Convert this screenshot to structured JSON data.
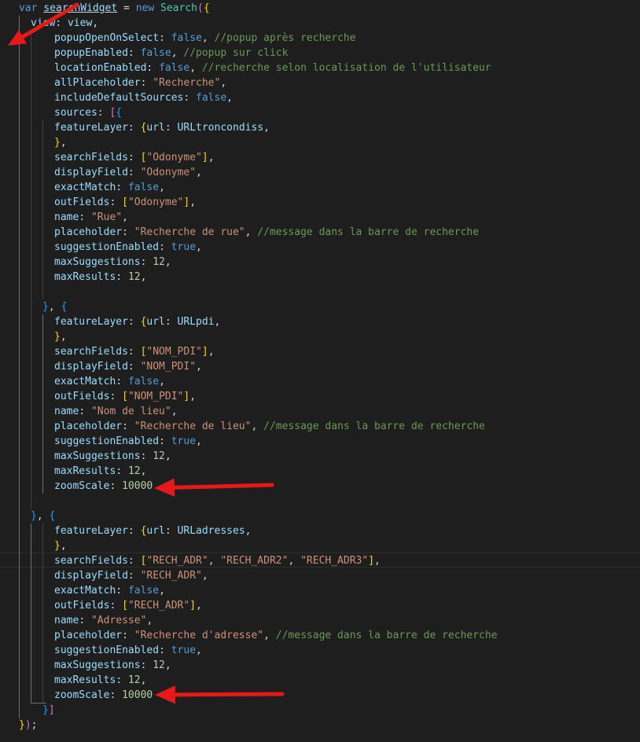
{
  "editor": {
    "language": "javascript",
    "lines": [
      {
        "indent": 0,
        "tokens": [
          [
            "kw",
            "var"
          ],
          [
            "p",
            " "
          ],
          [
            "var",
            "searchWidget"
          ],
          [
            "p",
            " = "
          ],
          [
            "kw",
            "new"
          ],
          [
            "p",
            " "
          ],
          [
            "cls",
            "Search"
          ],
          [
            "b2",
            "("
          ],
          [
            "b1",
            "{"
          ]
        ]
      },
      {
        "indent": 1,
        "tokens": [
          [
            "var",
            "view"
          ],
          [
            "p",
            ": "
          ],
          [
            "var",
            "view"
          ],
          [
            "p",
            ","
          ]
        ]
      },
      {
        "indent": 2,
        "tokens": [
          [
            "var",
            "popupOpenOnSelect"
          ],
          [
            "p",
            ": "
          ],
          [
            "kw",
            "false"
          ],
          [
            "p",
            ", "
          ],
          [
            "cmt",
            "//popup après recherche"
          ]
        ]
      },
      {
        "indent": 2,
        "tokens": [
          [
            "var",
            "popupEnabled"
          ],
          [
            "p",
            ": "
          ],
          [
            "kw",
            "false"
          ],
          [
            "p",
            ", "
          ],
          [
            "cmt",
            "//popup sur click"
          ]
        ]
      },
      {
        "indent": 2,
        "tokens": [
          [
            "var",
            "locationEnabled"
          ],
          [
            "p",
            ": "
          ],
          [
            "kw",
            "false"
          ],
          [
            "p",
            ", "
          ],
          [
            "cmt",
            "//recherche selon localisation de l'utilisateur"
          ]
        ]
      },
      {
        "indent": 2,
        "tokens": [
          [
            "var",
            "allPlaceholder"
          ],
          [
            "p",
            ": "
          ],
          [
            "str",
            "\"Recherche\""
          ],
          [
            "p",
            ","
          ]
        ]
      },
      {
        "indent": 2,
        "tokens": [
          [
            "var",
            "includeDefaultSources"
          ],
          [
            "p",
            ": "
          ],
          [
            "kw",
            "false"
          ],
          [
            "p",
            ","
          ]
        ]
      },
      {
        "indent": 2,
        "tokens": [
          [
            "var",
            "sources"
          ],
          [
            "p",
            ": "
          ],
          [
            "b2",
            "["
          ],
          [
            "b3",
            "{"
          ]
        ]
      },
      {
        "indent": 2,
        "tokens": [
          [
            "var",
            "featureLayer"
          ],
          [
            "p",
            ": "
          ],
          [
            "b1",
            "{"
          ],
          [
            "var",
            "url"
          ],
          [
            "p",
            ": "
          ],
          [
            "var",
            "URLtroncondiss"
          ],
          [
            "p",
            ","
          ]
        ]
      },
      {
        "indent": 2,
        "tokens": [
          [
            "b1",
            "}"
          ],
          [
            "p",
            ","
          ]
        ]
      },
      {
        "indent": 2,
        "tokens": [
          [
            "var",
            "searchFields"
          ],
          [
            "p",
            ": "
          ],
          [
            "b1",
            "["
          ],
          [
            "str",
            "\"Odonyme\""
          ],
          [
            "b1",
            "]"
          ],
          [
            "p",
            ","
          ]
        ]
      },
      {
        "indent": 2,
        "tokens": [
          [
            "var",
            "displayField"
          ],
          [
            "p",
            ": "
          ],
          [
            "str",
            "\"Odonyme\""
          ],
          [
            "p",
            ","
          ]
        ]
      },
      {
        "indent": 2,
        "tokens": [
          [
            "var",
            "exactMatch"
          ],
          [
            "p",
            ": "
          ],
          [
            "kw",
            "false"
          ],
          [
            "p",
            ","
          ]
        ]
      },
      {
        "indent": 2,
        "tokens": [
          [
            "var",
            "outFields"
          ],
          [
            "p",
            ": "
          ],
          [
            "b1",
            "["
          ],
          [
            "str",
            "\"Odonyme\""
          ],
          [
            "b1",
            "]"
          ],
          [
            "p",
            ","
          ]
        ]
      },
      {
        "indent": 2,
        "tokens": [
          [
            "var",
            "name"
          ],
          [
            "p",
            ": "
          ],
          [
            "str",
            "\"Rue\""
          ],
          [
            "p",
            ","
          ]
        ]
      },
      {
        "indent": 2,
        "tokens": [
          [
            "var",
            "placeholder"
          ],
          [
            "p",
            ": "
          ],
          [
            "str",
            "\"Recherche de rue\""
          ],
          [
            "p",
            ", "
          ],
          [
            "cmt",
            "//message dans la barre de recherche"
          ]
        ]
      },
      {
        "indent": 2,
        "tokens": [
          [
            "var",
            "suggestionEnabled"
          ],
          [
            "p",
            ": "
          ],
          [
            "kw",
            "true"
          ],
          [
            "p",
            ","
          ]
        ]
      },
      {
        "indent": 2,
        "tokens": [
          [
            "var",
            "maxSuggestions"
          ],
          [
            "p",
            ": "
          ],
          [
            "num",
            "12"
          ],
          [
            "p",
            ","
          ]
        ]
      },
      {
        "indent": 2,
        "tokens": [
          [
            "var",
            "maxResults"
          ],
          [
            "p",
            ": "
          ],
          [
            "num",
            "12"
          ],
          [
            "p",
            ","
          ]
        ]
      },
      {
        "indent": 0,
        "tokens": []
      },
      {
        "indent": 1.5,
        "tokens": [
          [
            "b3",
            "}"
          ],
          [
            "p",
            ", "
          ],
          [
            "b3",
            "{"
          ]
        ]
      },
      {
        "indent": 2,
        "tokens": [
          [
            "var",
            "featureLayer"
          ],
          [
            "p",
            ": "
          ],
          [
            "b1",
            "{"
          ],
          [
            "var",
            "url"
          ],
          [
            "p",
            ": "
          ],
          [
            "var",
            "URLpdi"
          ],
          [
            "p",
            ","
          ]
        ]
      },
      {
        "indent": 2,
        "tokens": [
          [
            "b1",
            "}"
          ],
          [
            "p",
            ","
          ]
        ]
      },
      {
        "indent": 2,
        "tokens": [
          [
            "var",
            "searchFields"
          ],
          [
            "p",
            ": "
          ],
          [
            "b1",
            "["
          ],
          [
            "str",
            "\"NOM_PDI\""
          ],
          [
            "b1",
            "]"
          ],
          [
            "p",
            ","
          ]
        ]
      },
      {
        "indent": 2,
        "tokens": [
          [
            "var",
            "displayField"
          ],
          [
            "p",
            ": "
          ],
          [
            "str",
            "\"NOM_PDI\""
          ],
          [
            "p",
            ","
          ]
        ]
      },
      {
        "indent": 2,
        "tokens": [
          [
            "var",
            "exactMatch"
          ],
          [
            "p",
            ": "
          ],
          [
            "kw",
            "false"
          ],
          [
            "p",
            ","
          ]
        ]
      },
      {
        "indent": 2,
        "tokens": [
          [
            "var",
            "outFields"
          ],
          [
            "p",
            ": "
          ],
          [
            "b1",
            "["
          ],
          [
            "str",
            "\"NOM_PDI\""
          ],
          [
            "b1",
            "]"
          ],
          [
            "p",
            ","
          ]
        ]
      },
      {
        "indent": 2,
        "tokens": [
          [
            "var",
            "name"
          ],
          [
            "p",
            ": "
          ],
          [
            "str",
            "\"Nom de lieu\""
          ],
          [
            "p",
            ","
          ]
        ]
      },
      {
        "indent": 2,
        "tokens": [
          [
            "var",
            "placeholder"
          ],
          [
            "p",
            ": "
          ],
          [
            "str",
            "\"Recherche de lieu\""
          ],
          [
            "p",
            ", "
          ],
          [
            "cmt",
            "//message dans la barre de recherche"
          ]
        ]
      },
      {
        "indent": 2,
        "tokens": [
          [
            "var",
            "suggestionEnabled"
          ],
          [
            "p",
            ": "
          ],
          [
            "kw",
            "true"
          ],
          [
            "p",
            ","
          ]
        ]
      },
      {
        "indent": 2,
        "tokens": [
          [
            "var",
            "maxSuggestions"
          ],
          [
            "p",
            ": "
          ],
          [
            "num",
            "12"
          ],
          [
            "p",
            ","
          ]
        ]
      },
      {
        "indent": 2,
        "tokens": [
          [
            "var",
            "maxResults"
          ],
          [
            "p",
            ": "
          ],
          [
            "num",
            "12"
          ],
          [
            "p",
            ","
          ]
        ]
      },
      {
        "indent": 2,
        "tokens": [
          [
            "var",
            "zoomScale"
          ],
          [
            "p",
            ": "
          ],
          [
            "num",
            "10000"
          ]
        ]
      },
      {
        "indent": 0,
        "tokens": []
      },
      {
        "indent": 1,
        "tokens": [
          [
            "b3",
            "}"
          ],
          [
            "p",
            ", "
          ],
          [
            "b3",
            "{"
          ]
        ]
      },
      {
        "indent": 2,
        "tokens": [
          [
            "var",
            "featureLayer"
          ],
          [
            "p",
            ": "
          ],
          [
            "b1",
            "{"
          ],
          [
            "var",
            "url"
          ],
          [
            "p",
            ": "
          ],
          [
            "var",
            "URLadresses"
          ],
          [
            "p",
            ","
          ]
        ]
      },
      {
        "indent": 2,
        "tokens": [
          [
            "b1",
            "}"
          ],
          [
            "p",
            ","
          ]
        ]
      },
      {
        "indent": 2,
        "tokens": [
          [
            "var",
            "searchFields"
          ],
          [
            "p",
            ": "
          ],
          [
            "b1",
            "["
          ],
          [
            "str",
            "\"RECH_ADR\""
          ],
          [
            "p",
            ", "
          ],
          [
            "str",
            "\"RECH_ADR2\""
          ],
          [
            "p",
            ", "
          ],
          [
            "str",
            "\"RECH_ADR3\""
          ],
          [
            "b1",
            "]"
          ],
          [
            "p",
            ","
          ]
        ]
      },
      {
        "indent": 2,
        "tokens": [
          [
            "var",
            "displayField"
          ],
          [
            "p",
            ": "
          ],
          [
            "str",
            "\"RECH_ADR\""
          ],
          [
            "p",
            ","
          ]
        ]
      },
      {
        "indent": 2,
        "tokens": [
          [
            "var",
            "exactMatch"
          ],
          [
            "p",
            ": "
          ],
          [
            "kw",
            "false"
          ],
          [
            "p",
            ","
          ]
        ]
      },
      {
        "indent": 2,
        "tokens": [
          [
            "var",
            "outFields"
          ],
          [
            "p",
            ": "
          ],
          [
            "b1",
            "["
          ],
          [
            "str",
            "\"RECH_ADR\""
          ],
          [
            "b1",
            "]"
          ],
          [
            "p",
            ","
          ]
        ]
      },
      {
        "indent": 2,
        "tokens": [
          [
            "var",
            "name"
          ],
          [
            "p",
            ": "
          ],
          [
            "str",
            "\"Adresse\""
          ],
          [
            "p",
            ","
          ]
        ]
      },
      {
        "indent": 2,
        "tokens": [
          [
            "var",
            "placeholder"
          ],
          [
            "p",
            ": "
          ],
          [
            "str",
            "\"Recherche d'adresse\""
          ],
          [
            "p",
            ", "
          ],
          [
            "cmt",
            "//message dans la barre de recherche"
          ]
        ]
      },
      {
        "indent": 2,
        "tokens": [
          [
            "var",
            "suggestionEnabled"
          ],
          [
            "p",
            ": "
          ],
          [
            "kw",
            "true"
          ],
          [
            "p",
            ","
          ]
        ]
      },
      {
        "indent": 2,
        "tokens": [
          [
            "var",
            "maxSuggestions"
          ],
          [
            "p",
            ": "
          ],
          [
            "num",
            "12"
          ],
          [
            "p",
            ","
          ]
        ]
      },
      {
        "indent": 2,
        "tokens": [
          [
            "var",
            "maxResults"
          ],
          [
            "p",
            ": "
          ],
          [
            "num",
            "12"
          ],
          [
            "p",
            ","
          ]
        ]
      },
      {
        "indent": 2,
        "tokens": [
          [
            "var",
            "zoomScale"
          ],
          [
            "p",
            ": "
          ],
          [
            "num",
            "10000"
          ]
        ]
      },
      {
        "indent": 1.5,
        "tokens": [
          [
            "b3",
            "}"
          ],
          [
            "b2",
            "]"
          ]
        ]
      },
      {
        "indent": 0,
        "tokens": [
          [
            "b1",
            "}"
          ],
          [
            "b2",
            ")"
          ],
          [
            "p",
            ";"
          ]
        ]
      }
    ]
  },
  "annotations": {
    "arrow_color": "#e81818",
    "arrows": [
      "arrow-to-searchWidget",
      "arrow-to-zoomScale-1",
      "arrow-to-zoomScale-2"
    ]
  }
}
